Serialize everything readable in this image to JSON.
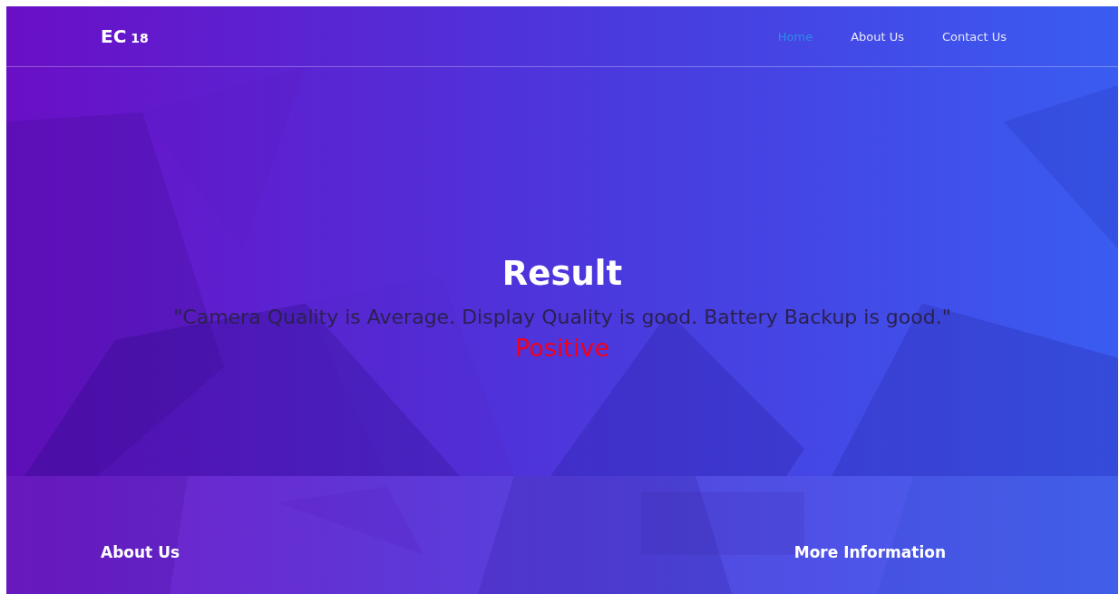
{
  "brand": {
    "name": "EC",
    "number": "18"
  },
  "nav": [
    {
      "label": "Home",
      "selected": true
    },
    {
      "label": "About Us",
      "selected": false
    },
    {
      "label": "Contact Us",
      "selected": false
    }
  ],
  "result": {
    "title": "Result",
    "review": "\"Camera Quality is Average. Display Quality is good. Battery Backup is good.\"",
    "sentiment": "Positive",
    "kind": "positive"
  },
  "footer": {
    "columns": [
      {
        "title": "About Us"
      },
      {
        "title": "More Information"
      }
    ]
  }
}
